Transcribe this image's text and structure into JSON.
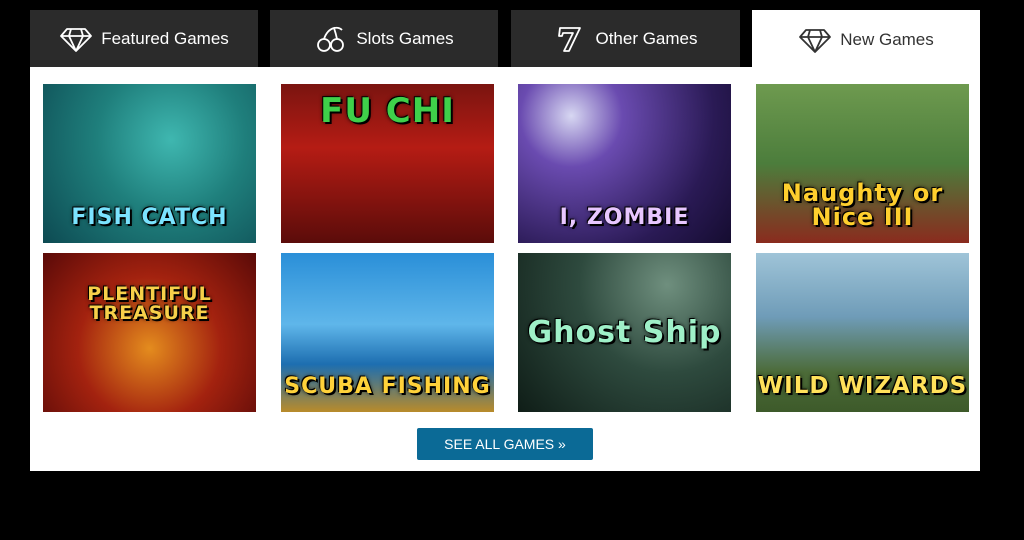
{
  "tabs": [
    {
      "label": "Featured Games",
      "icon": "diamond-icon",
      "active": false
    },
    {
      "label": "Slots Games",
      "icon": "cherries-icon",
      "active": false
    },
    {
      "label": "Other Games",
      "icon": "lucky-seven-icon",
      "active": false
    },
    {
      "label": "New Games",
      "icon": "diamond-icon",
      "active": true
    }
  ],
  "games": [
    {
      "title": "FISH CATCH"
    },
    {
      "title": "FU CHI"
    },
    {
      "title": "I, ZOMBIE"
    },
    {
      "title": "Naughty or Nice III"
    },
    {
      "title": "PLENTIFUL TREASURE"
    },
    {
      "title": "SCUBA FISHING"
    },
    {
      "title": "Ghost Ship"
    },
    {
      "title": "WILD WIZARDS"
    }
  ],
  "see_all": {
    "label": "SEE ALL GAMES »"
  },
  "colors": {
    "page_background": "#000000",
    "tab_inactive": "#2b2b2b",
    "tab_active": "#ffffff",
    "button": "#0b6a96"
  }
}
